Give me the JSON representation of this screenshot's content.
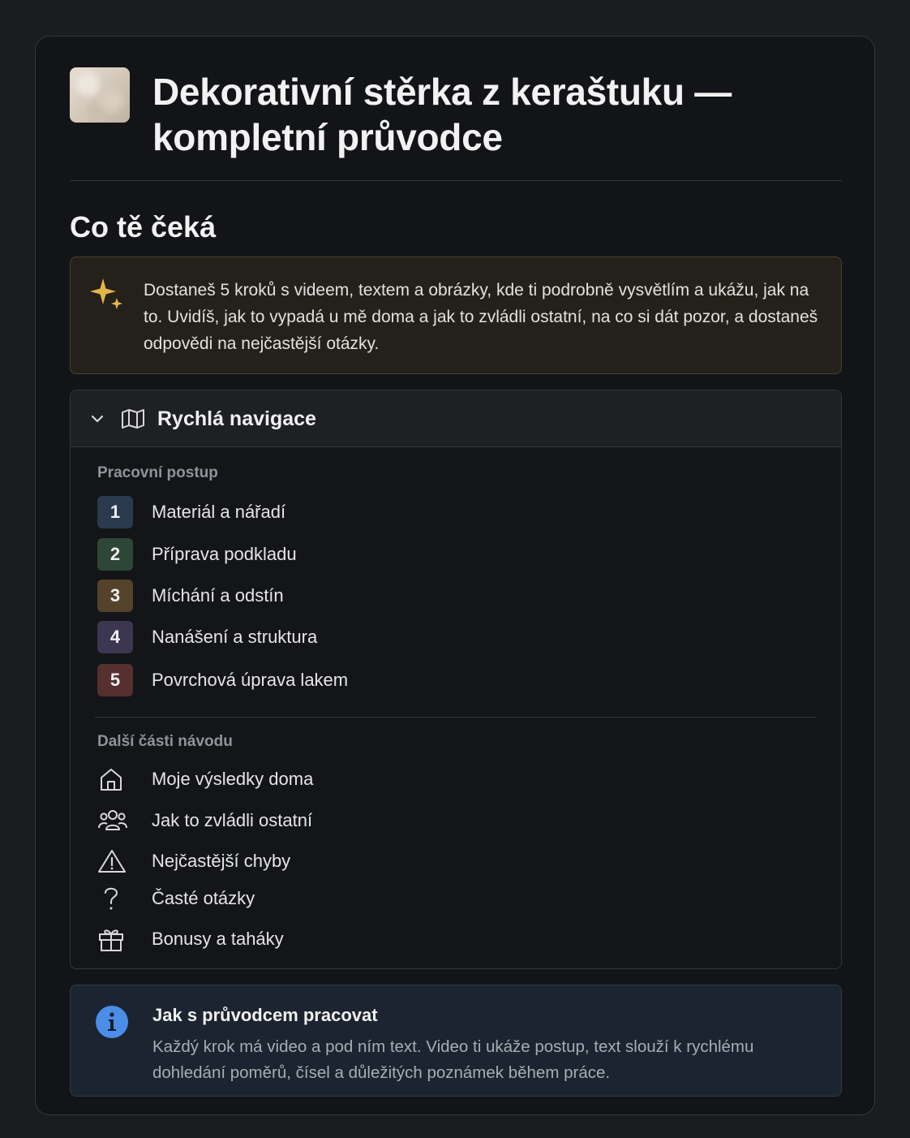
{
  "header": {
    "title": "Dekorativní stěrka z keraštuku — kompletní průvodce"
  },
  "overview": {
    "heading": "Co tě čeká",
    "callout_text": "Dostaneš 5 kroků s videem, textem a obrázky, kde ti podrobně vysvětlím a ukážu, jak na to. Uvidíš, jak to vypadá u mě doma a jak to zvládli ostatní, na co si dát pozor, a dostaneš odpovědi na nejčastější otázky.",
    "callout_icon": "sparkle-icon"
  },
  "navigation": {
    "title": "Rychlá navigace",
    "toggle_icon": "chevron-down-icon",
    "title_icon": "map-icon",
    "steps_label": "Pracovní postup",
    "steps": [
      {
        "number": "1",
        "label": "Materiál a nářadí",
        "color": "#2b3a4e"
      },
      {
        "number": "2",
        "label": "Příprava podkladu",
        "color": "#2e4636"
      },
      {
        "number": "3",
        "label": "Míchání a odstín",
        "color": "#54432a"
      },
      {
        "number": "4",
        "label": "Nanášení a struktura",
        "color": "#3c3650"
      },
      {
        "number": "5",
        "label": "Povrchová úprava lakem",
        "color": "#55302f"
      }
    ],
    "more_label": "Další části návodu",
    "links": [
      {
        "icon": "home-icon",
        "label": "Moje výsledky doma"
      },
      {
        "icon": "people-icon",
        "label": "Jak to zvládli ostatní"
      },
      {
        "icon": "warning-icon",
        "label": "Nejčastější chyby"
      },
      {
        "icon": "question-icon",
        "label": "Časté otázky"
      },
      {
        "icon": "gift-icon",
        "label": "Bonusy a taháky"
      }
    ]
  },
  "info": {
    "icon": "info-icon",
    "title": "Jak s průvodcem pracovat",
    "text": "Každý krok má video a pod ním text. Video ti ukáže postup, text slouží k rychlému dohledání poměrů, čísel a důležitých poznámek během práce."
  },
  "colors": {
    "accent_gold": "#e0b84a",
    "info_blue": "#4a8ee8"
  }
}
